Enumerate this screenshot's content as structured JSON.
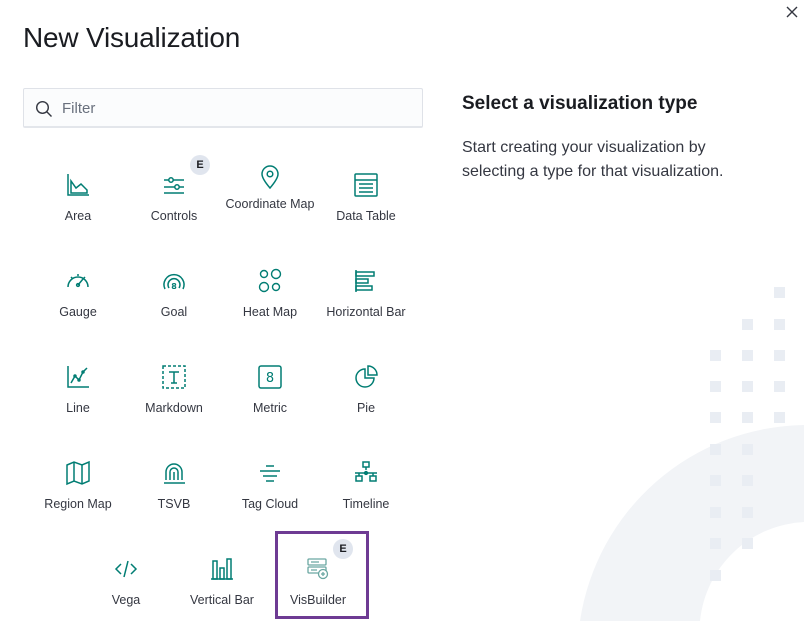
{
  "modal": {
    "title": "New Visualization",
    "close_icon": "close-icon"
  },
  "filter": {
    "placeholder": "Filter",
    "value": ""
  },
  "info": {
    "title": "Select a visualization type",
    "description": "Start creating your visualization by selecting a type for that visualization."
  },
  "types": [
    {
      "label": "Area",
      "icon": "area-chart-icon"
    },
    {
      "label": "Controls",
      "icon": "controls-icon",
      "badge": "E"
    },
    {
      "label": "Coordinate Map",
      "icon": "map-marker-icon"
    },
    {
      "label": "Data Table",
      "icon": "table-icon"
    },
    {
      "label": "Gauge",
      "icon": "gauge-icon"
    },
    {
      "label": "Goal",
      "icon": "goal-icon"
    },
    {
      "label": "Heat Map",
      "icon": "heatmap-icon"
    },
    {
      "label": "Horizontal Bar",
      "icon": "horizontal-bar-icon"
    },
    {
      "label": "Line",
      "icon": "line-chart-icon"
    },
    {
      "label": "Markdown",
      "icon": "markdown-icon"
    },
    {
      "label": "Metric",
      "icon": "metric-icon"
    },
    {
      "label": "Pie",
      "icon": "pie-chart-icon"
    },
    {
      "label": "Region Map",
      "icon": "region-map-icon"
    },
    {
      "label": "TSVB",
      "icon": "tsvb-icon"
    },
    {
      "label": "Tag Cloud",
      "icon": "tag-cloud-icon"
    },
    {
      "label": "Timeline",
      "icon": "timeline-icon"
    },
    {
      "label": "Vega",
      "icon": "code-icon"
    },
    {
      "label": "Vertical Bar",
      "icon": "vertical-bar-icon"
    },
    {
      "label": "VisBuilder",
      "icon": "visbuilder-icon",
      "badge": "E",
      "selected": true
    }
  ],
  "colors": {
    "icon": "#017d73",
    "selected_border": "#6e3b93",
    "badge_bg": "#e0e5ee",
    "decor": "#e9edf3"
  }
}
